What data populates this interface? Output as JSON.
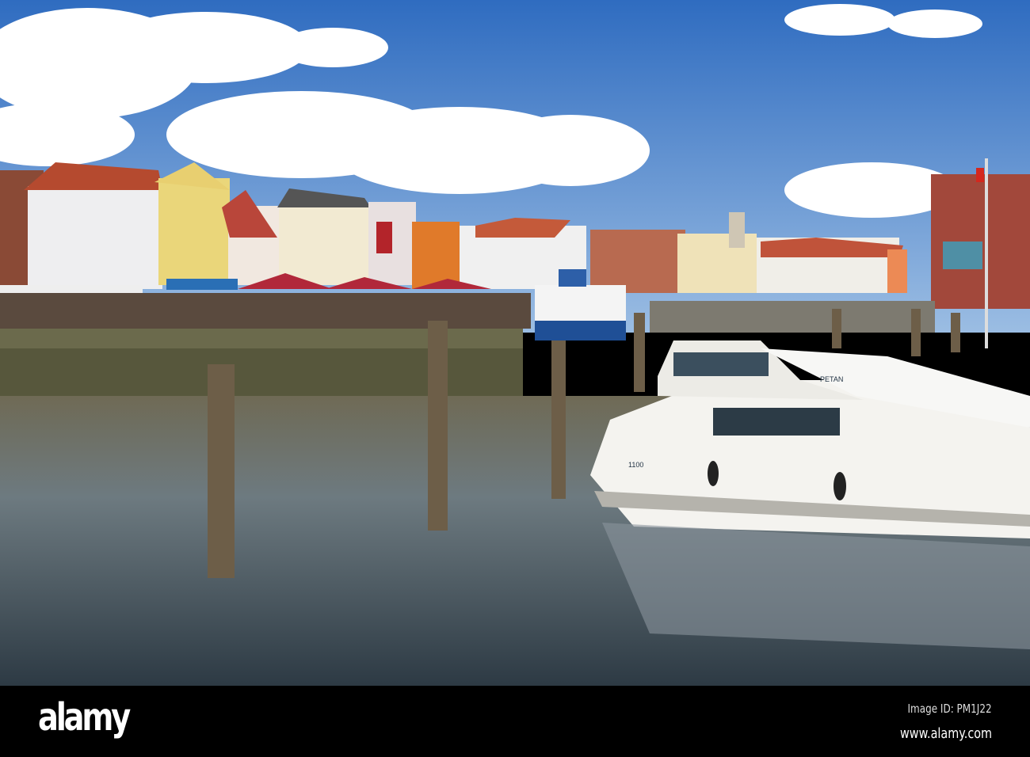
{
  "photo": {
    "subject": "harbour",
    "boat_names": [
      "PETAN",
      "1100"
    ],
    "colors": {
      "sky_top": "#2f6cc0",
      "sky_low": "#8db4df",
      "water": "#5d6a6e",
      "quay": "#6b6a4c",
      "banner": "#000000"
    }
  },
  "banner": {
    "logo": "alamy",
    "image_id": "Image ID: PM1J22",
    "url": "www.alamy.com"
  }
}
